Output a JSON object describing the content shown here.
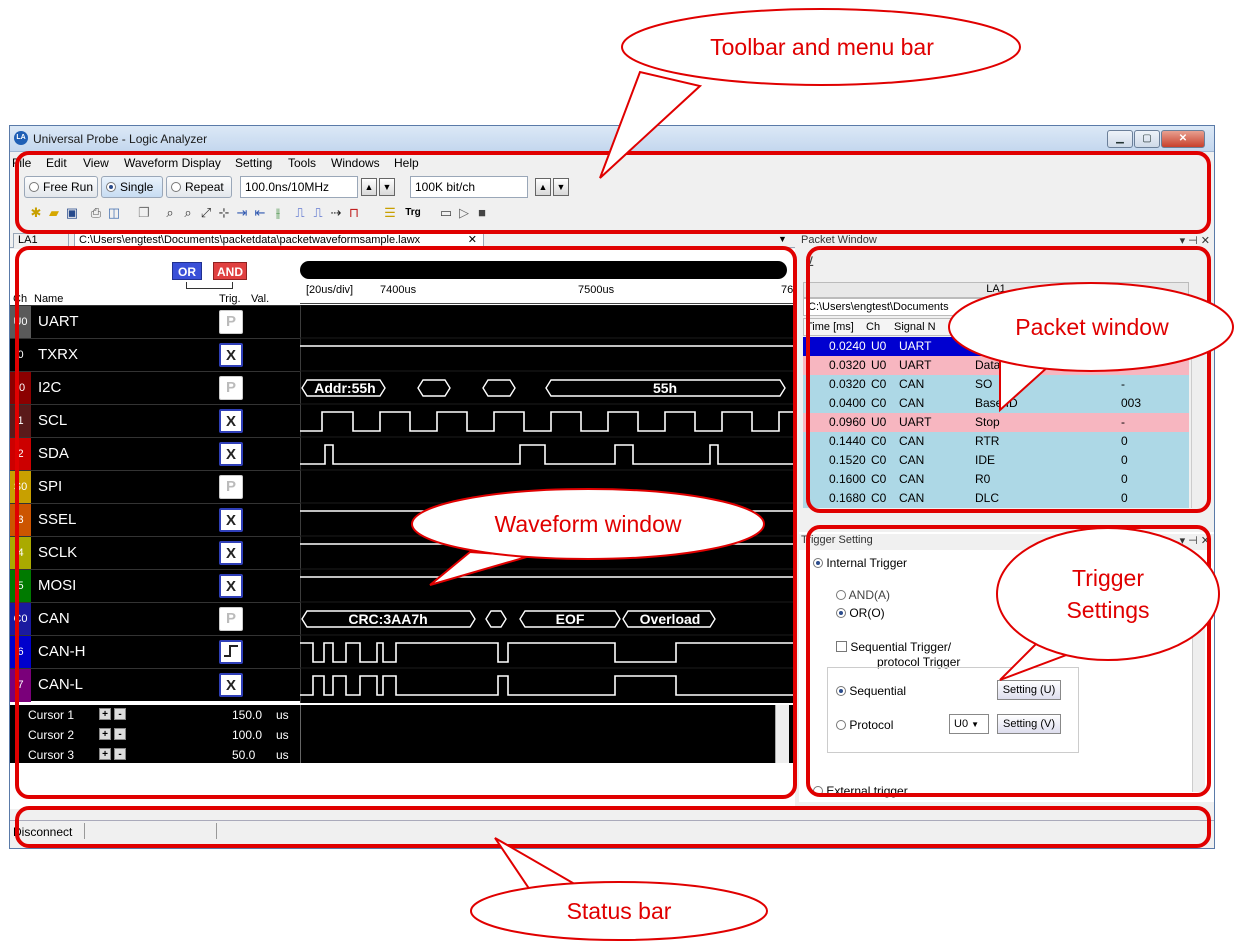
{
  "window": {
    "title": "Universal Probe - Logic Analyzer",
    "app_icon": "LA",
    "minimize_glyph": "▁",
    "maximize_glyph": "▢",
    "close_glyph": "✕"
  },
  "menu": [
    "File",
    "Edit",
    "View",
    "Waveform Display",
    "Setting",
    "Tools",
    "Windows",
    "Help"
  ],
  "toolbar": {
    "free_run": "Free Run",
    "single": "Single",
    "repeat": "Repeat",
    "sample_rate": "100.0ns/10MHz",
    "bits": "100K bit/ch",
    "trg_label": "Trg",
    "selected_mode": "Single"
  },
  "tabs": {
    "la1": "LA1",
    "file": "C:\\Users\\engtest\\Documents\\packetdata\\packetwaveformsample.lawx",
    "close": "✕",
    "dropdown": "▼"
  },
  "waveform": {
    "or_label": "OR",
    "and_label": "AND",
    "col_ch": "Ch",
    "col_name": "Name",
    "col_trig": "Trig.",
    "col_val": "Val.",
    "scale": "[20us/div]",
    "tick1": "7400us",
    "tick2": "7500us",
    "tick3": "76",
    "channels": [
      {
        "num": "U0",
        "name": "UART",
        "trig": "P",
        "color": "#5a5a5a"
      },
      {
        "num": "0",
        "name": "TXRX",
        "trig": "X",
        "color": "#000000"
      },
      {
        "num": "I0",
        "name": "I2C",
        "trig": "P",
        "color": "#8b0000"
      },
      {
        "num": "1",
        "name": "SCL",
        "trig": "X",
        "color": "#5a1a1a"
      },
      {
        "num": "2",
        "name": "SDA",
        "trig": "X",
        "color": "#cc0000"
      },
      {
        "num": "S0",
        "name": "SPI",
        "trig": "P",
        "color": "#c8a000"
      },
      {
        "num": "3",
        "name": "SSEL",
        "trig": "X",
        "color": "#cc5500"
      },
      {
        "num": "4",
        "name": "SCLK",
        "trig": "X",
        "color": "#aaaa00"
      },
      {
        "num": "5",
        "name": "MOSI",
        "trig": "X",
        "color": "#007a00"
      },
      {
        "num": "C0",
        "name": "CAN",
        "trig": "P",
        "color": "#1a1aa0"
      },
      {
        "num": "6",
        "name": "CAN-H",
        "trig": "edge",
        "color": "#0000cc"
      },
      {
        "num": "7",
        "name": "CAN-L",
        "trig": "X",
        "color": "#7a007a"
      }
    ],
    "i2c_labels": [
      "Addr:55h",
      "55h"
    ],
    "can_labels": [
      "CRC:3AA7h",
      "EOF",
      "Overload"
    ]
  },
  "cursors": [
    {
      "name": "Cursor 1",
      "value": "150.0",
      "unit": "us"
    },
    {
      "name": "Cursor 2",
      "value": "100.0",
      "unit": "us"
    },
    {
      "name": "Cursor 3",
      "value": "50.0",
      "unit": "us"
    }
  ],
  "packet_window": {
    "title": "Packet Window",
    "pin": "▾ ⊣ ✕",
    "group": "LA1",
    "path": "C:\\Users\\engtest\\Documents",
    "headers": [
      "Time [ms]",
      "Ch",
      "Signal N"
    ],
    "rows": [
      {
        "time": "0.0240",
        "ch": "U0",
        "proto": "UART",
        "signal": "St",
        "val": "",
        "bg": "#0000d0",
        "fg": "#ffffff"
      },
      {
        "time": "0.0320",
        "ch": "U0",
        "proto": "UART",
        "signal": "Data",
        "val": "F4",
        "bg": "#f7b6c0",
        "fg": "#000000"
      },
      {
        "time": "0.0320",
        "ch": "C0",
        "proto": "CAN",
        "signal": "SO",
        "val": "-",
        "bg": "#add8e6",
        "fg": "#000000"
      },
      {
        "time": "0.0400",
        "ch": "C0",
        "proto": "CAN",
        "signal": "Base ID",
        "val": "003",
        "bg": "#add8e6",
        "fg": "#000000"
      },
      {
        "time": "0.0960",
        "ch": "U0",
        "proto": "UART",
        "signal": "Stop",
        "val": "-",
        "bg": "#f7b6c0",
        "fg": "#000000"
      },
      {
        "time": "0.1440",
        "ch": "C0",
        "proto": "CAN",
        "signal": "RTR",
        "val": "0",
        "bg": "#add8e6",
        "fg": "#000000"
      },
      {
        "time": "0.1520",
        "ch": "C0",
        "proto": "CAN",
        "signal": "IDE",
        "val": "0",
        "bg": "#add8e6",
        "fg": "#000000"
      },
      {
        "time": "0.1600",
        "ch": "C0",
        "proto": "CAN",
        "signal": "R0",
        "val": "0",
        "bg": "#add8e6",
        "fg": "#000000"
      },
      {
        "time": "0.1680",
        "ch": "C0",
        "proto": "CAN",
        "signal": "DLC",
        "val": "0",
        "bg": "#add8e6",
        "fg": "#000000"
      }
    ]
  },
  "trigger_setting": {
    "title": "Trigger Setting",
    "internal": "Internal Trigger",
    "and": "AND(A)",
    "or": "OR(O)",
    "sequential_check": "Sequential Trigger/",
    "protocol_trigger": "protocol Trigger",
    "sequential": "Sequential",
    "protocol": "Protocol",
    "protocol_ch": "U0",
    "setting_u": "Setting (U)",
    "setting_v": "Setting (V)",
    "external": "External trigger"
  },
  "status": {
    "connection": "Disconnect"
  },
  "annotations": {
    "toolbar": "Toolbar and menu bar",
    "waveform": "Waveform window",
    "packet": "Packet window",
    "trigger_l1": "Trigger",
    "trigger_l2": "Settings",
    "status": "Status bar"
  },
  "colors": {
    "annotation": "#e00000",
    "selection": "#0000d0",
    "uart_row": "#f7b6c0",
    "can_row": "#add8e6"
  }
}
